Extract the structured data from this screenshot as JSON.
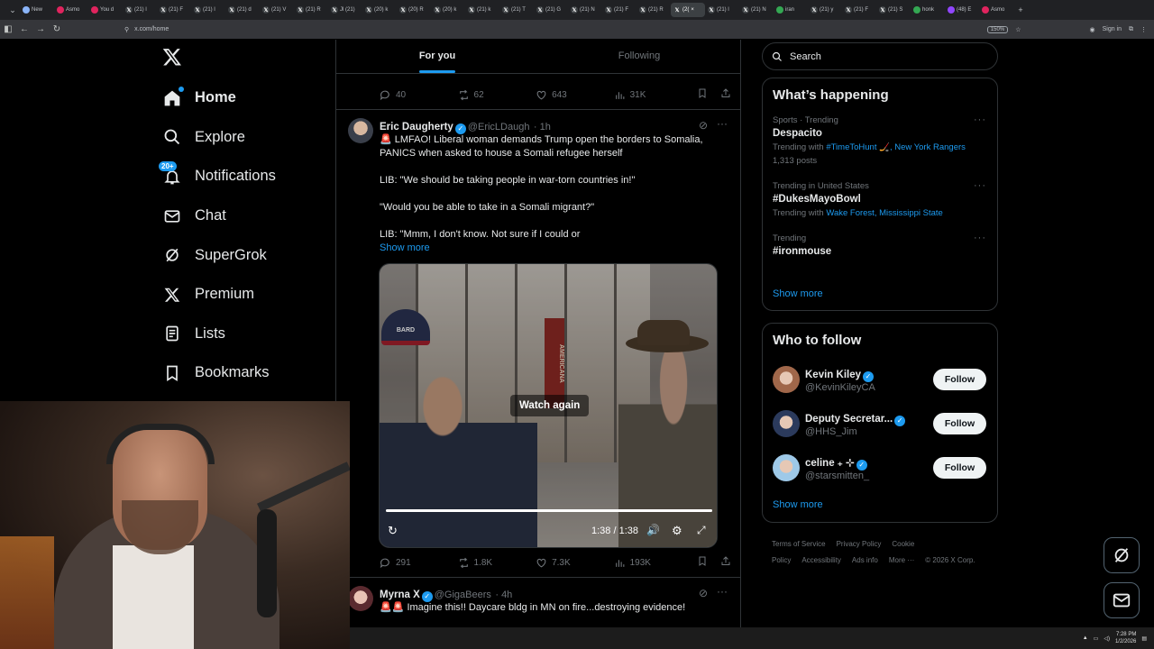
{
  "browser": {
    "tabs": [
      {
        "label": "New",
        "icon": "chrome-icon",
        "color": "#8ab4f8"
      },
      {
        "label": "Asmo",
        "icon": "asmon-icon",
        "color": "#e0245e"
      },
      {
        "label": "You d",
        "icon": "asmon-icon",
        "color": "#e0245e"
      },
      {
        "label": "(21) l",
        "icon": "x-icon",
        "color": "#000"
      },
      {
        "label": "(21) F",
        "icon": "x-icon",
        "color": "#000"
      },
      {
        "label": "(21) l",
        "icon": "x-icon",
        "color": "#000"
      },
      {
        "label": "(21) d",
        "icon": "x-icon",
        "color": "#000"
      },
      {
        "label": "(21) V",
        "icon": "x-icon",
        "color": "#000"
      },
      {
        "label": "(21) R",
        "icon": "x-icon",
        "color": "#000"
      },
      {
        "label": "Jl (21)",
        "icon": "x-icon",
        "color": "#000"
      },
      {
        "label": "(20) k",
        "icon": "x-icon",
        "color": "#000"
      },
      {
        "label": "(20) R",
        "icon": "x-icon",
        "color": "#000"
      },
      {
        "label": "(20) k",
        "icon": "x-icon",
        "color": "#000"
      },
      {
        "label": "(21) k",
        "icon": "x-icon",
        "color": "#000"
      },
      {
        "label": "(21) T",
        "icon": "x-icon",
        "color": "#000"
      },
      {
        "label": "(21) G",
        "icon": "x-icon",
        "color": "#000"
      },
      {
        "label": "(21) N",
        "icon": "x-icon",
        "color": "#000"
      },
      {
        "label": "(21) F",
        "icon": "x-icon",
        "color": "#000"
      },
      {
        "label": "(21) R",
        "icon": "x-icon",
        "color": "#000"
      },
      {
        "label": "(2(",
        "icon": "x-icon",
        "color": "#000",
        "active": true
      },
      {
        "label": "(21) l",
        "icon": "x-icon",
        "color": "#000"
      },
      {
        "label": "(21) N",
        "icon": "x-icon",
        "color": "#000"
      },
      {
        "label": "iran",
        "icon": "globe-icon",
        "color": "#34a853"
      },
      {
        "label": "(21) y",
        "icon": "x-icon",
        "color": "#000"
      },
      {
        "label": "(21) F",
        "icon": "x-icon",
        "color": "#000"
      },
      {
        "label": "(21) S",
        "icon": "x-icon",
        "color": "#000"
      },
      {
        "label": "honk",
        "icon": "globe-icon",
        "color": "#34a853"
      },
      {
        "label": "(48) E",
        "icon": "twitch-icon",
        "color": "#9146ff"
      },
      {
        "label": "Asmo",
        "icon": "asmon-icon",
        "color": "#e0245e"
      }
    ],
    "url": "x.com/home",
    "zoom": "150%",
    "sign_in": "Sign in"
  },
  "nav": {
    "items": [
      {
        "label": "Home",
        "icon": "home-icon",
        "bold": true
      },
      {
        "label": "Explore",
        "icon": "search-icon"
      },
      {
        "label": "Notifications",
        "icon": "bell-icon",
        "badge": "20+"
      },
      {
        "label": "Chat",
        "icon": "mail-icon"
      },
      {
        "label": "SuperGrok",
        "icon": "grok-icon"
      },
      {
        "label": "Premium",
        "icon": "x-icon"
      },
      {
        "label": "Lists",
        "icon": "list-icon"
      },
      {
        "label": "Bookmarks",
        "icon": "bookmark-icon"
      }
    ]
  },
  "feed": {
    "tabs": [
      "For you",
      "Following"
    ],
    "prev_actions": {
      "replies": "40",
      "reposts": "62",
      "likes": "643",
      "views": "31K"
    },
    "tweet1": {
      "name": "Eric Daugherty",
      "handle": "@EricLDaugh",
      "time": "· 1h",
      "lines": [
        "🚨 LMFAO! Liberal woman demands Trump open the borders to Somalia, PANICS when asked to house a Somali refugee herself",
        "LIB: \"We should be taking people in war-torn countries in!\"",
        "\"Would you be able to take in a Somali migrant?\"",
        "LIB: \"Mmm, I don't know. Not sure if I could or"
      ],
      "show_more": "Show more",
      "video": {
        "watch_again": "Watch again",
        "time": "1:38 / 1:38",
        "progress": 1.0,
        "sign_left": "BARD",
        "sign_right": "AMERICANA"
      },
      "actions": {
        "replies": "291",
        "reposts": "1.8K",
        "likes": "7.3K",
        "views": "193K"
      }
    },
    "tweet2": {
      "name": "Myrna X",
      "handle": "@GigaBeers",
      "time": "· 4h",
      "text": "🚨🚨 Imagine this!! Daycare bldg in MN on fire...destroying evidence!"
    }
  },
  "right": {
    "search_placeholder": "Search",
    "happening_title": "What’s happening",
    "trends": [
      {
        "meta": "Sports · Trending",
        "title": "Despacito",
        "sub_prefix": "Trending with ",
        "links": "#TimeToHunt 🏒, New York Rangers",
        "posts": "1,313 posts"
      },
      {
        "meta": "Trending in United States",
        "title": "#DukesMayoBowl",
        "sub_prefix": "Trending with ",
        "links": "Wake Forest, Mississippi State",
        "posts": ""
      },
      {
        "meta": "Trending",
        "title": "#ironmouse",
        "sub_prefix": "",
        "links": "",
        "posts": ""
      }
    ],
    "show_more": "Show more",
    "who_title": "Who to follow",
    "who": [
      {
        "name": "Kevin Kiley",
        "handle": "@KevinKileyCA",
        "follow": "Follow",
        "color": "#a0674a"
      },
      {
        "name": "Deputy Secretar...",
        "handle": "@HHS_Jim",
        "follow": "Follow",
        "color": "#2b3a5c"
      },
      {
        "name": "celine ₊ ⊹",
        "handle": "@starsmitten_",
        "follow": "Follow",
        "color": "#9ec9e8"
      }
    ],
    "footer": [
      "Terms of Service",
      "Privacy Policy",
      "Cookie Policy",
      "Accessibility",
      "Ads info",
      "More ···",
      "© 2026 X Corp."
    ]
  },
  "taskbar": {
    "time": "7:28 PM",
    "date": "1/2/2026"
  }
}
